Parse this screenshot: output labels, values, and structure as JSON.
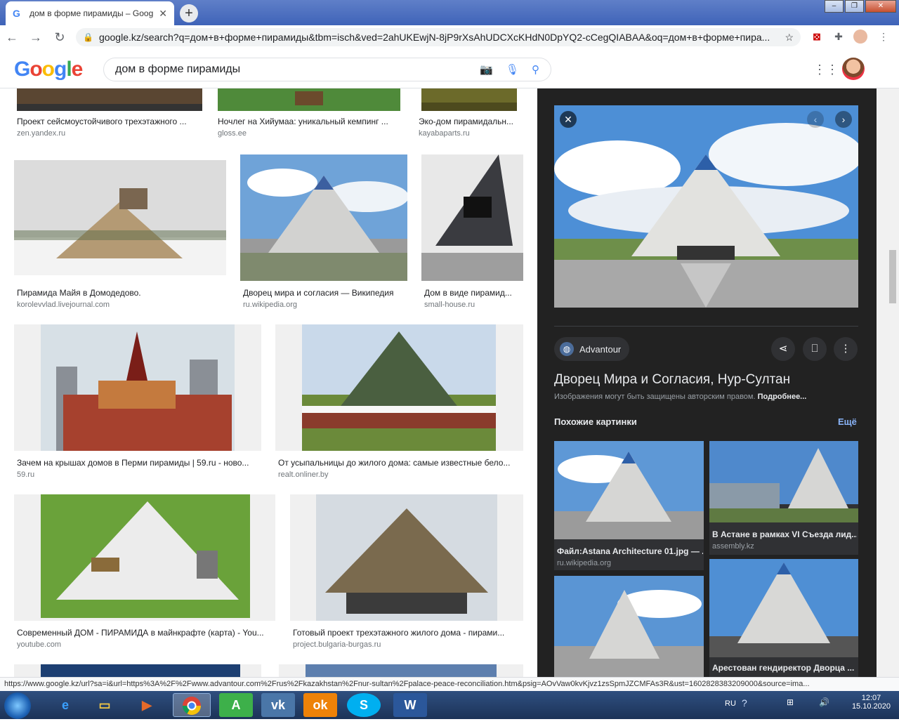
{
  "browser": {
    "tab_title": "дом в форме пирамиды – Goog",
    "url": "google.kz/search?q=дом+в+форме+пирамиды&tbm=isch&ved=2ahUKEwjN-8jP9rXsAhUDCXcKHdN0DpYQ2-cCegQIABAA&oq=дом+в+форме+пира...",
    "new_tab": "+",
    "status_url": "https://www.google.kz/url?sa=i&url=https%3A%2F%2Fwww.advantour.com%2Frus%2Fkazakhstan%2Fnur-sultan%2Fpalace-peace-reconciliation.htm&psig=AOvVaw0kvKjvz1zsSpmJZCMFAs3R&ust=1602828383209000&source=ima..."
  },
  "google": {
    "logo": "Google",
    "query": "дом в форме пирамиды"
  },
  "results": [
    {
      "caption": "Проект сейсмоустойчивого трехэтажного ...",
      "source": "zen.yandex.ru"
    },
    {
      "caption": "Ночлег на Хийумаа: уникальный кемпинг ...",
      "source": "gloss.ee"
    },
    {
      "caption": "Эко-дом пирамидальн...",
      "source": "kayabaparts.ru"
    },
    {
      "caption": "Пирамида Майя в Домодедово.",
      "source": "korolevvlad.livejournal.com"
    },
    {
      "caption": "Дворец мира и согласия — Википедия",
      "source": "ru.wikipedia.org"
    },
    {
      "caption": "Дом в виде пирамид...",
      "source": "small-house.ru"
    },
    {
      "caption": "Зачем на крышах домов в Перми пирамиды | 59.ru - ново...",
      "source": "59.ru"
    },
    {
      "caption": "От усыпальницы до жилого дома: самые известные бело...",
      "source": "realt.onliner.by"
    },
    {
      "caption": "Современный ДОМ - ПИРАМИДА в майнкрафте (карта) - You...",
      "source": "youtube.com"
    },
    {
      "caption": "Готовый проект трехэтажного жилого дома - пирами...",
      "source": "project.bulgaria-burgas.ru"
    }
  ],
  "panel": {
    "site": "Advantour",
    "title": "Дворец Мира и Согласия, Нур-Султан",
    "note": "Изображения могут быть защищены авторским правом.",
    "note_link": "Подробнее...",
    "similar_label": "Похожие картинки",
    "more_label": "Ещё",
    "similar": [
      {
        "caption": "Файл:Astana Architecture 01.jpg — ...",
        "source": "ru.wikipedia.org"
      },
      {
        "caption": "В Астане в рамках VI Съезда лид...",
        "source": "assembly.kz"
      },
      {
        "caption": "",
        "source": ""
      },
      {
        "caption": "Арестован гендиректор Дворца ...",
        "source": ""
      }
    ]
  },
  "taskbar": {
    "lang": "RU",
    "time": "12:07",
    "date": "15.10.2020"
  },
  "colors": {
    "panel_bg": "#222222",
    "link_blue": "#8ab4f8"
  }
}
